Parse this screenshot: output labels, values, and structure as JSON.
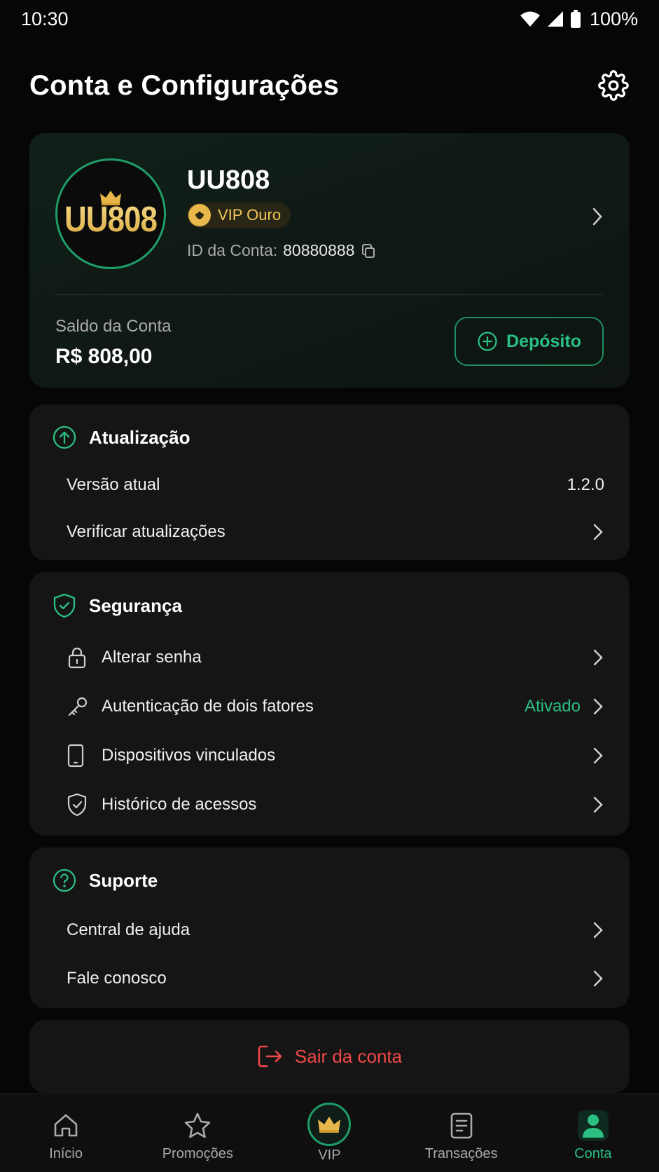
{
  "status_bar": {
    "time": "10:30",
    "battery": "100%"
  },
  "header": {
    "title": "Conta e Configurações"
  },
  "profile": {
    "avatar_text": "UU808",
    "name": "UU808",
    "vip_label": "VIP Ouro",
    "account_id_label": "ID da Conta:",
    "account_id": "80880888",
    "balance_label": "Saldo da Conta",
    "balance_value": "R$ 808,00",
    "deposit_label": "Depósito"
  },
  "update": {
    "title": "Atualização",
    "current_version_label": "Versão atual",
    "current_version_value": "1.2.0",
    "check_updates_label": "Verificar atualizações"
  },
  "security": {
    "title": "Segurança",
    "items": [
      {
        "label": "Alterar senha",
        "icon": "lock-icon"
      },
      {
        "label": "Autenticação de dois fatores",
        "icon": "key-icon",
        "status": "Ativado"
      },
      {
        "label": "Dispositivos vinculados",
        "icon": "device-icon"
      },
      {
        "label": "Histórico de acessos",
        "icon": "shield-check-icon"
      }
    ]
  },
  "support": {
    "title": "Suporte",
    "items": [
      {
        "label": "Central de ajuda"
      },
      {
        "label": "Fale conosco"
      }
    ]
  },
  "logout": {
    "label": "Sair da conta"
  },
  "bottom_nav": {
    "items": [
      {
        "label": "Início",
        "icon": "home-icon"
      },
      {
        "label": "Promoções",
        "icon": "star-icon"
      },
      {
        "label": "VIP",
        "icon": "crown-icon"
      },
      {
        "label": "Transações",
        "icon": "document-icon"
      },
      {
        "label": "Conta",
        "icon": "user-icon",
        "active": true
      }
    ]
  },
  "colors": {
    "accent_green": "#2bbf82",
    "gold": "#f0c75b",
    "danger_red": "#f04848",
    "background": "#060606",
    "card": "#151515"
  }
}
